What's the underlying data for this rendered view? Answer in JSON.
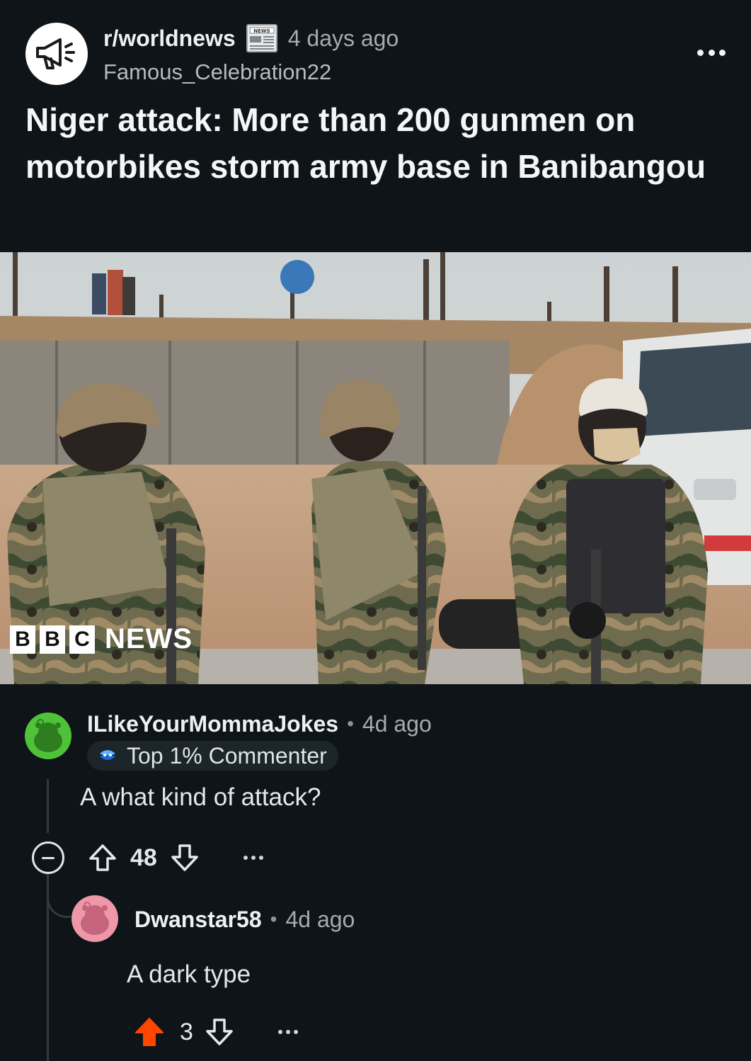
{
  "post": {
    "subreddit": "r/worldnews",
    "flair_icon": "newspaper-icon",
    "flair_icon_text": "NEWS",
    "age": "4 days ago",
    "author": "Famous_Celebration22",
    "title": "Niger attack: More than 200 gunmen on motorbikes storm army base in Banibangou",
    "image_watermark": [
      "B",
      "B",
      "C",
      "NEWS"
    ]
  },
  "comments": [
    {
      "username": "ILikeYourMommaJokes",
      "separator": "•",
      "age": "4d ago",
      "flair": "Top 1% Commenter",
      "body": "A what kind of attack?",
      "votes": "48",
      "avatar_color": "#4fc23a"
    },
    {
      "username": "Dwanstar58",
      "separator": "•",
      "age": "4d ago",
      "body": "A dark type",
      "votes": "3",
      "upvoted": true,
      "avatar_color": "#ee97a8"
    }
  ],
  "colors": {
    "background": "#0e1417",
    "upvote_active": "#ff4500",
    "thread_line": "#2f3b41"
  }
}
